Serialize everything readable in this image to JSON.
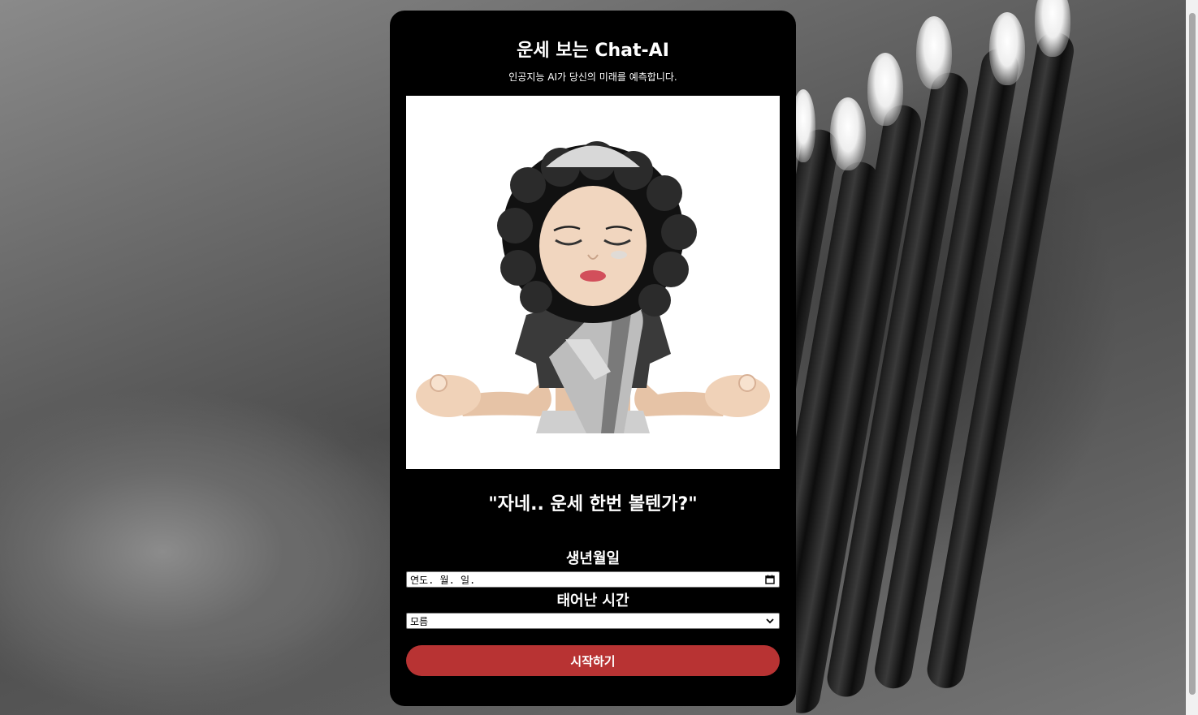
{
  "colors": {
    "card_background": "#000000",
    "button_background": "#b83333",
    "text": "#ffffff"
  },
  "header": {
    "title": "운세 보는 Chat-AI",
    "subtitle": "인공지능 AI가 당신의 미래를 예측합니다."
  },
  "hero": {
    "image_icon": "meditating-memoji-avatar"
  },
  "quote": "\"자네.. 운세 한번 볼텐가?\"",
  "form": {
    "birthdate_label": "생년월일",
    "birthdate_value": "연도. 월. 일.",
    "birthtime_label": "태어난 시간",
    "birthtime_value": "모름",
    "start_button_label": "시작하기"
  }
}
